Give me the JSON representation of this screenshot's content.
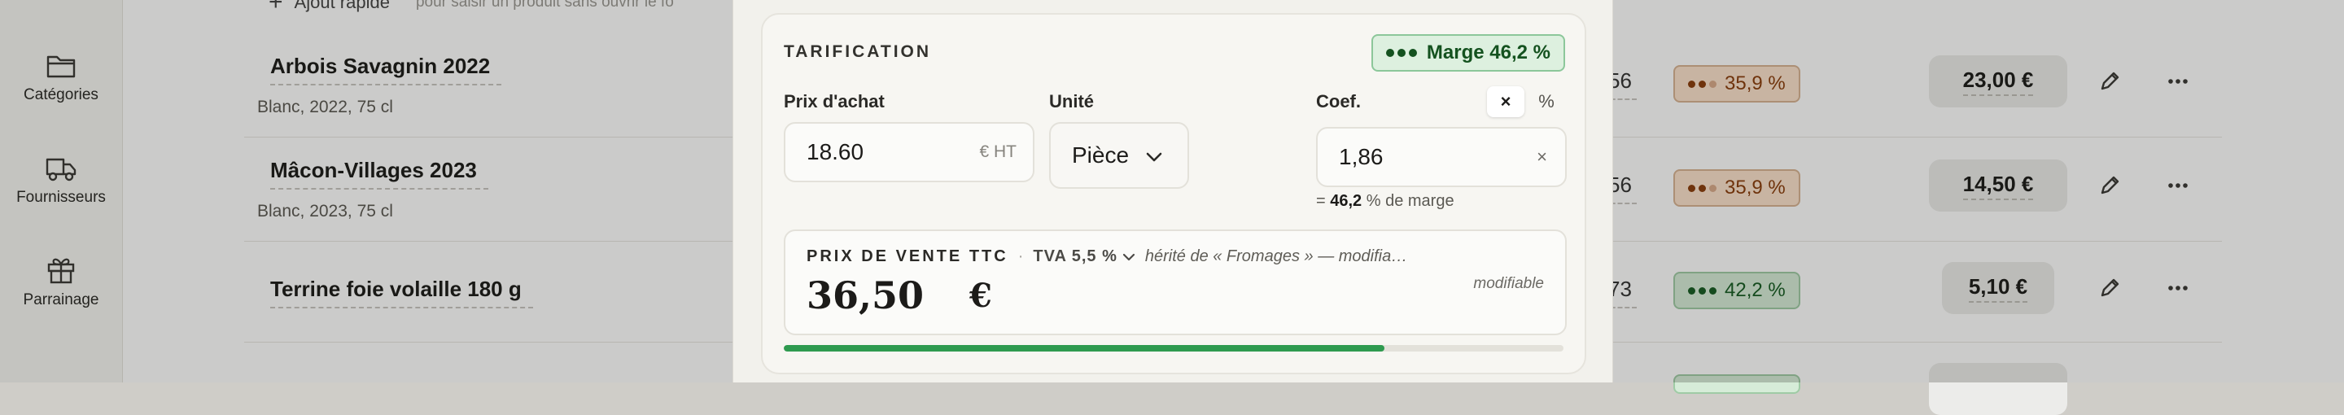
{
  "sidebar": {
    "items": [
      {
        "label": "Catégories",
        "icon": "folder-icon"
      },
      {
        "label": "Fournisseurs",
        "icon": "truck-icon"
      },
      {
        "label": "Parrainage",
        "icon": "gift-icon"
      }
    ]
  },
  "quick_add": {
    "label": "Ajout rapide",
    "hint": "pour saisir un produit sans ouvrir le fo"
  },
  "products": [
    {
      "name": "Arbois Savagnin 2022",
      "sub": "Blanc, 2022, 75 cl",
      "num": "56",
      "margin": "35,9 %",
      "status": "orange",
      "price": "23,00 €"
    },
    {
      "name": "Mâcon-Villages 2023",
      "sub": "Blanc, 2023, 75 cl",
      "num": "56",
      "margin": "35,9 %",
      "status": "orange",
      "price": "14,50 €"
    },
    {
      "name": "Terrine foie volaille 180 g",
      "sub": "",
      "num": "73",
      "margin": "42,2 %",
      "status": "green",
      "price": "5,10 €"
    }
  ],
  "modal": {
    "section_title": "TARIFICATION",
    "margin_badge": "Marge 46,2 %",
    "purchase_label": "Prix d'achat",
    "purchase_value": "18.60",
    "purchase_suffix": "€ HT",
    "unit_label": "Unité",
    "unit_value": "Pièce",
    "coef_label": "Coef.",
    "coef_toggle_x": "×",
    "coef_toggle_pct": "%",
    "coef_value": "1,86",
    "coef_clear": "×",
    "margin_note_prefix": "=",
    "margin_note_value": "46,2",
    "margin_note_suffix": "% de marge",
    "sale": {
      "title": "PRIX DE VENTE TTC",
      "separator": "·",
      "tva": "TVA 5,5 %",
      "inherited": "hérité de « Fromages » — modifia…",
      "modifiable": "modifiable",
      "amount": "36,50",
      "currency": "€"
    },
    "margin_progress": 0.77
  },
  "colors": {
    "accent_green": "#2e9a4f",
    "badge_orange": "#fbe2cc",
    "badge_green": "#d6ecd8"
  }
}
